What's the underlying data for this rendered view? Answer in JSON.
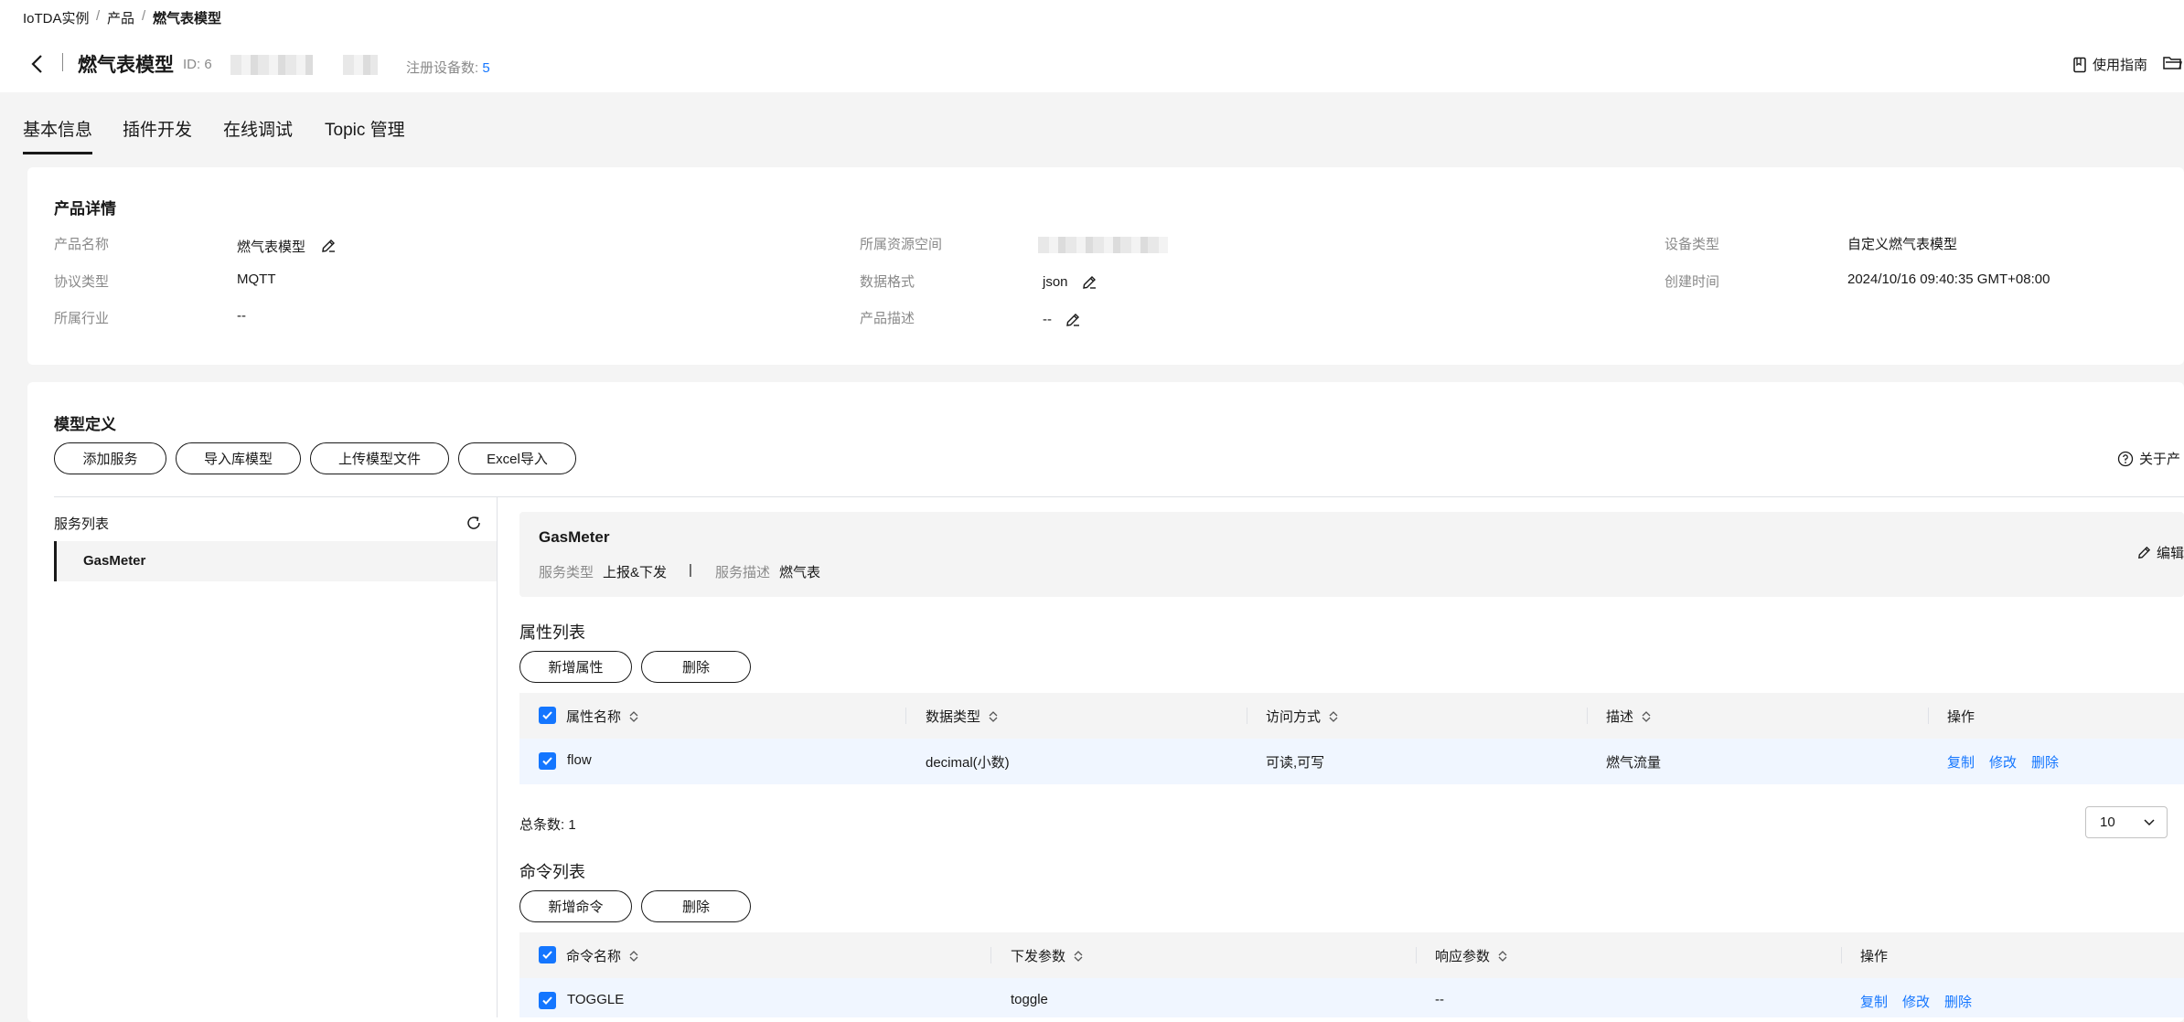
{
  "breadcrumb": [
    "IoTDA实例",
    "/",
    "产品",
    "/",
    "燃气表模型"
  ],
  "header": {
    "title": "燃气表模型",
    "id_label": "ID: 6",
    "registered_label": "注册设备数:",
    "registered_count": "5",
    "guide": "使用指南"
  },
  "tabs": [
    "基本信息",
    "插件开发",
    "在线调试",
    "Topic 管理"
  ],
  "product_details": {
    "heading": "产品详情",
    "fields": {
      "name_label": "产品名称",
      "name_value": "燃气表模型",
      "protocol_label": "协议类型",
      "protocol_value": "MQTT",
      "industry_label": "所属行业",
      "industry_value": "--",
      "space_label": "所属资源空间",
      "format_label": "数据格式",
      "format_value": "json",
      "desc_label": "产品描述",
      "desc_value": "--",
      "device_type_label": "设备类型",
      "device_type_value": "自定义燃气表模型",
      "created_label": "创建时间",
      "created_value": "2024/10/16 09:40:35 GMT+08:00"
    }
  },
  "model": {
    "heading": "模型定义",
    "buttons": [
      "添加服务",
      "导入库模型",
      "上传模型文件",
      "Excel导入"
    ],
    "about": "关于产",
    "service_list_label": "服务列表",
    "services": [
      "GasMeter"
    ],
    "service": {
      "name": "GasMeter",
      "type_label": "服务类型",
      "type_value": "上报&下发",
      "divider": "|",
      "desc_label": "服务描述",
      "desc_value": "燃气表",
      "edit": "编辑"
    },
    "properties": {
      "heading": "属性列表",
      "add_button": "新增属性",
      "delete_button": "删除",
      "columns": [
        "属性名称",
        "数据类型",
        "访问方式",
        "描述",
        "操作"
      ],
      "rows": [
        {
          "name": "flow",
          "type": "decimal(小数)",
          "access": "可读,可写",
          "desc": "燃气流量"
        }
      ],
      "actions": [
        "复制",
        "修改",
        "删除"
      ],
      "total_label": "总条数:",
      "total": "1",
      "page_size": "10"
    },
    "commands": {
      "heading": "命令列表",
      "add_button": "新增命令",
      "delete_button": "删除",
      "columns": [
        "命令名称",
        "下发参数",
        "响应参数",
        "操作"
      ],
      "rows": [
        {
          "name": "TOGGLE",
          "params": "toggle",
          "response": "--"
        }
      ],
      "actions": [
        "复制",
        "修改",
        "删除"
      ]
    }
  },
  "colors": {
    "accent": "#1476ff",
    "text": "#191919",
    "muted": "#8a8a8a",
    "bg": "#f4f4f4"
  }
}
